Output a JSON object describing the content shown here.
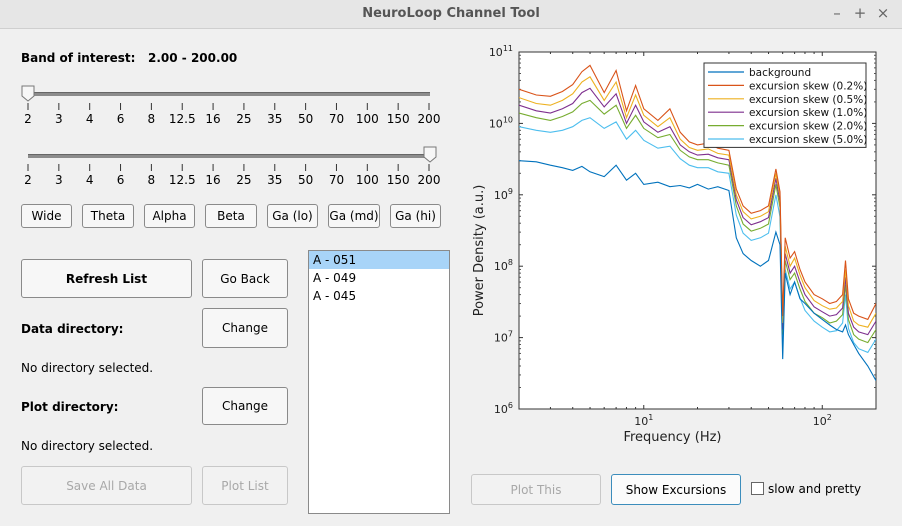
{
  "window": {
    "title": "NeuroLoop Channel Tool",
    "minimize_glyph": "–",
    "maximize_glyph": "+",
    "close_glyph": "×"
  },
  "band": {
    "label": "Band of interest:",
    "range_text": "2.00 - 200.00",
    "low_value": 2,
    "high_value": 200
  },
  "slider_ticks": [
    "2",
    "3",
    "4",
    "6",
    "8",
    "12.5",
    "16",
    "25",
    "35",
    "50",
    "70",
    "100",
    "150",
    "200"
  ],
  "band_buttons": [
    "Wide",
    "Theta",
    "Alpha",
    "Beta",
    "Ga (lo)",
    "Ga (md)",
    "Ga (hi)"
  ],
  "buttons": {
    "refresh": "Refresh List",
    "go_back": "Go Back",
    "change_data": "Change",
    "change_plot": "Change",
    "save_all": "Save All Data",
    "plot_list": "Plot List",
    "plot_this": "Plot This",
    "show_excursions": "Show Excursions"
  },
  "data_dir": {
    "label": "Data directory:",
    "status": "No directory selected."
  },
  "plot_dir": {
    "label": "Plot directory:",
    "status": "No directory selected."
  },
  "channel_list": {
    "items": [
      "A - 051",
      "A - 049",
      "A - 045"
    ],
    "selected_index": 0
  },
  "option": {
    "label": "slow and pretty",
    "checked": false
  },
  "chart_data": {
    "type": "line",
    "xlabel": "Frequency (Hz)",
    "ylabel": "Power Density (a.u.)",
    "x_scale": "log",
    "y_scale": "log",
    "xlim": [
      2,
      200
    ],
    "ylim": [
      1000000,
      100000000000
    ],
    "x_tick_labels": [
      "10^1",
      "10^2"
    ],
    "y_tick_labels": [
      "10^6",
      "10^7",
      "10^8",
      "10^9",
      "10^10",
      "10^11"
    ],
    "legend_position": "top-right",
    "x": [
      2,
      2.5,
      3,
      3.5,
      4,
      4.5,
      5,
      6,
      7,
      8,
      9,
      10,
      12,
      14,
      16,
      18,
      20,
      23,
      26,
      30,
      33,
      36,
      40,
      45,
      50,
      55,
      58,
      60,
      62,
      66,
      70,
      75,
      80,
      90,
      100,
      110,
      120,
      130,
      135,
      140,
      150,
      160,
      180,
      200
    ],
    "series": [
      {
        "name": "background",
        "color": "#0072bd",
        "values": [
          3000000000.0,
          2900000000.0,
          2600000000.0,
          2400000000.0,
          2200000000.0,
          2500000000.0,
          2100000000.0,
          1800000000.0,
          2600000000.0,
          1600000000.0,
          2000000000.0,
          1400000000.0,
          1500000000.0,
          1300000000.0,
          1350000000.0,
          1250000000.0,
          1400000000.0,
          1200000000.0,
          1300000000.0,
          1150000000.0,
          250000000.0,
          150000000.0,
          120000000.0,
          100000000.0,
          120000000.0,
          300000000.0,
          200000000.0,
          5000000.0,
          80000000.0,
          40000000.0,
          60000000.0,
          35000000.0,
          30000000.0,
          22000000.0,
          18000000.0,
          15000000.0,
          13000000.0,
          12000000.0,
          15000000.0,
          11000000.0,
          8000000.0,
          6000000.0,
          4000000.0,
          2500000.0
        ]
      },
      {
        "name": "excursion skew (0.2%)",
        "color": "#d95319",
        "values": [
          30000000000.0,
          25000000000.0,
          24000000000.0,
          28000000000.0,
          35000000000.0,
          53000000000.0,
          65000000000.0,
          27000000000.0,
          55000000000.0,
          15000000000.0,
          34000000000.0,
          16000000000.0,
          11000000000.0,
          16000000000.0,
          7500000000.0,
          5500000000.0,
          5000000000.0,
          5300000000.0,
          4500000000.0,
          4200000000.0,
          1200000000.0,
          700000000.0,
          550000000.0,
          600000000.0,
          700000000.0,
          2300000000.0,
          1100000000.0,
          20000000.0,
          250000000.0,
          130000000.0,
          160000000.0,
          90000000.0,
          60000000.0,
          40000000.0,
          35000000.0,
          30000000.0,
          32000000.0,
          40000000.0,
          120000000.0,
          35000000.0,
          22000000.0,
          20000000.0,
          18000000.0,
          30000000.0
        ]
      },
      {
        "name": "excursion skew (0.5%)",
        "color": "#edb120",
        "values": [
          23000000000.0,
          19000000000.0,
          18000000000.0,
          21000000000.0,
          26000000000.0,
          38000000000.0,
          45000000000.0,
          21000000000.0,
          38000000000.0,
          12000000000.0,
          25000000000.0,
          13000000000.0,
          9000000000.0,
          12000000000.0,
          6000000000.0,
          4600000000.0,
          4200000000.0,
          4400000000.0,
          3800000000.0,
          3600000000.0,
          1000000000.0,
          580000000.0,
          460000000.0,
          500000000.0,
          580000000.0,
          2000000000.0,
          950000000.0,
          16000000.0,
          190000000.0,
          100000000.0,
          130000000.0,
          75000000.0,
          50000000.0,
          33000000.0,
          28000000.0,
          25000000.0,
          26000000.0,
          32000000.0,
          90000000.0,
          28000000.0,
          17000000.0,
          15000000.0,
          14000000.0,
          22000000.0
        ]
      },
      {
        "name": "excursion skew (1.0%)",
        "color": "#7e2f8e",
        "values": [
          18000000000.0,
          15000000000.0,
          14000000000.0,
          16000000000.0,
          19000000000.0,
          27000000000.0,
          31000000000.0,
          17000000000.0,
          26000000000.0,
          10000000000.0,
          18000000000.0,
          10500000000.0,
          7500000000.0,
          9000000000.0,
          5000000000.0,
          4000000000.0,
          3600000000.0,
          3700000000.0,
          3300000000.0,
          3100000000.0,
          850000000.0,
          480000000.0,
          380000000.0,
          420000000.0,
          480000000.0,
          1700000000.0,
          800000000.0,
          13000000.0,
          150000000.0,
          80000000.0,
          100000000.0,
          60000000.0,
          40000000.0,
          27000000.0,
          23000000.0,
          20000000.0,
          21000000.0,
          26000000.0,
          70000000.0,
          22000000.0,
          14000000.0,
          12000000.0,
          11000000.0,
          17000000.0
        ]
      },
      {
        "name": "excursion skew (2.0%)",
        "color": "#77ac30",
        "values": [
          14000000000.0,
          12000000000.0,
          11000000000.0,
          12500000000.0,
          14500000000.0,
          19000000000.0,
          21000000000.0,
          13500000000.0,
          18000000000.0,
          8500000000.0,
          13000000000.0,
          8500000000.0,
          6300000000.0,
          7000000000.0,
          4200000000.0,
          3400000000.0,
          3100000000.0,
          3100000000.0,
          2800000000.0,
          2600000000.0,
          700000000.0,
          390000000.0,
          310000000.0,
          340000000.0,
          390000000.0,
          1400000000.0,
          660000000.0,
          11000000.0,
          120000000.0,
          65000000.0,
          80000000.0,
          48000000.0,
          32000000.0,
          22000000.0,
          19000000.0,
          16000000.0,
          17000000.0,
          21000000.0,
          55000000.0,
          18000000.0,
          11000000.0,
          9500000.0,
          8500000.0,
          13000000.0
        ]
      },
      {
        "name": "excursion skew (5.0%)",
        "color": "#4dbeee",
        "values": [
          9000000000.0,
          8000000000.0,
          7500000000.0,
          8000000000.0,
          9000000000.0,
          11000000000.0,
          12000000000.0,
          8500000000.0,
          10500000000.0,
          6000000000.0,
          8000000000.0,
          5800000000.0,
          4500000000.0,
          4800000000.0,
          3200000000.0,
          2600000000.0,
          2400000000.0,
          2400000000.0,
          2100000000.0,
          2000000000.0,
          520000000.0,
          290000000.0,
          230000000.0,
          250000000.0,
          290000000.0,
          1000000000.0,
          490000000.0,
          8000000.0,
          90000000.0,
          48000000.0,
          60000000.0,
          36000000.0,
          24000000.0,
          17000000.0,
          14000000.0,
          12000000.0,
          12500000.0,
          16000000.0,
          40000000.0,
          13500000.0,
          8500000.0,
          7000000.0,
          6200000.0,
          9500000.0
        ]
      }
    ]
  }
}
